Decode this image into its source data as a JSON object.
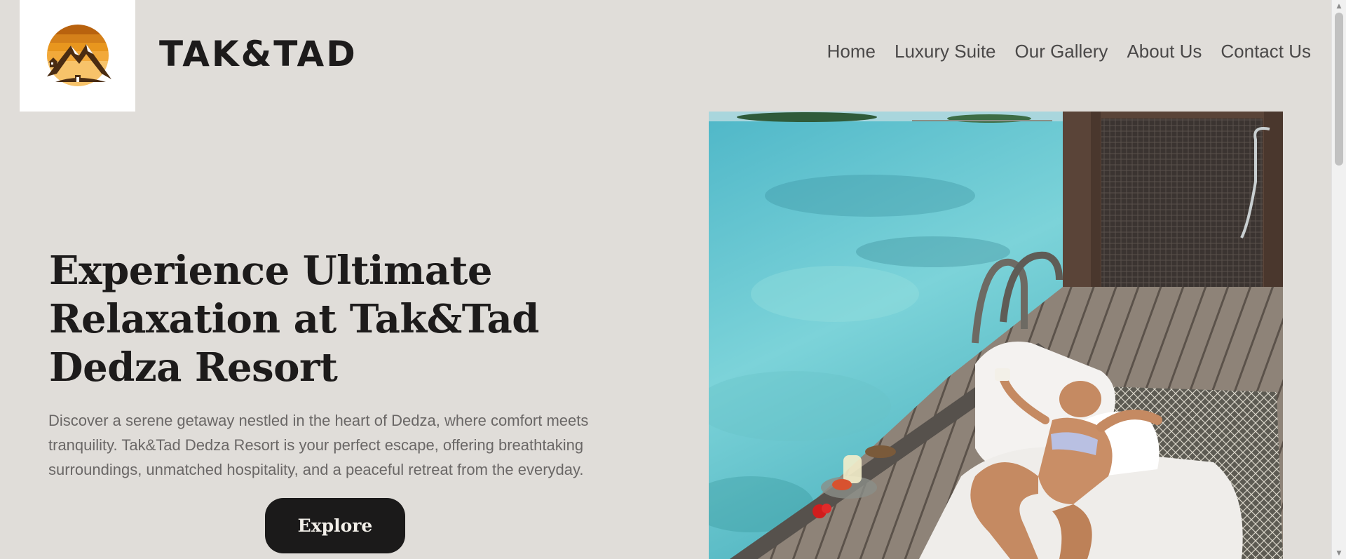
{
  "header": {
    "brand": "TAK&TAD",
    "logo_icon": "mountain-sunset-house-logo",
    "nav": [
      "Home",
      "Luxury Suite",
      "Our Gallery",
      "About Us",
      "Contact Us"
    ]
  },
  "hero": {
    "title": "Experience Ultimate Relaxation at Tak&Tad Dedza Resort",
    "description": "Discover a serene getaway nestled in the heart of Dedza, where comfort meets tranquility. Tak&Tad Dedza Resort is your perfect escape, offering breathtaking surroundings, unmatched hospitality, and a peaceful retreat from the everyday.",
    "cta_label": "Explore",
    "image_subject": "woman relaxing on overwater net hammock"
  },
  "colors": {
    "background": "#e0ddd9",
    "text_dark": "#1d1b1b",
    "text_muted": "#6a6766",
    "button_bg": "#1b1a1a",
    "button_text": "#f2efe9",
    "logo_orange": "#e8961e",
    "logo_brown": "#4a2c12"
  }
}
